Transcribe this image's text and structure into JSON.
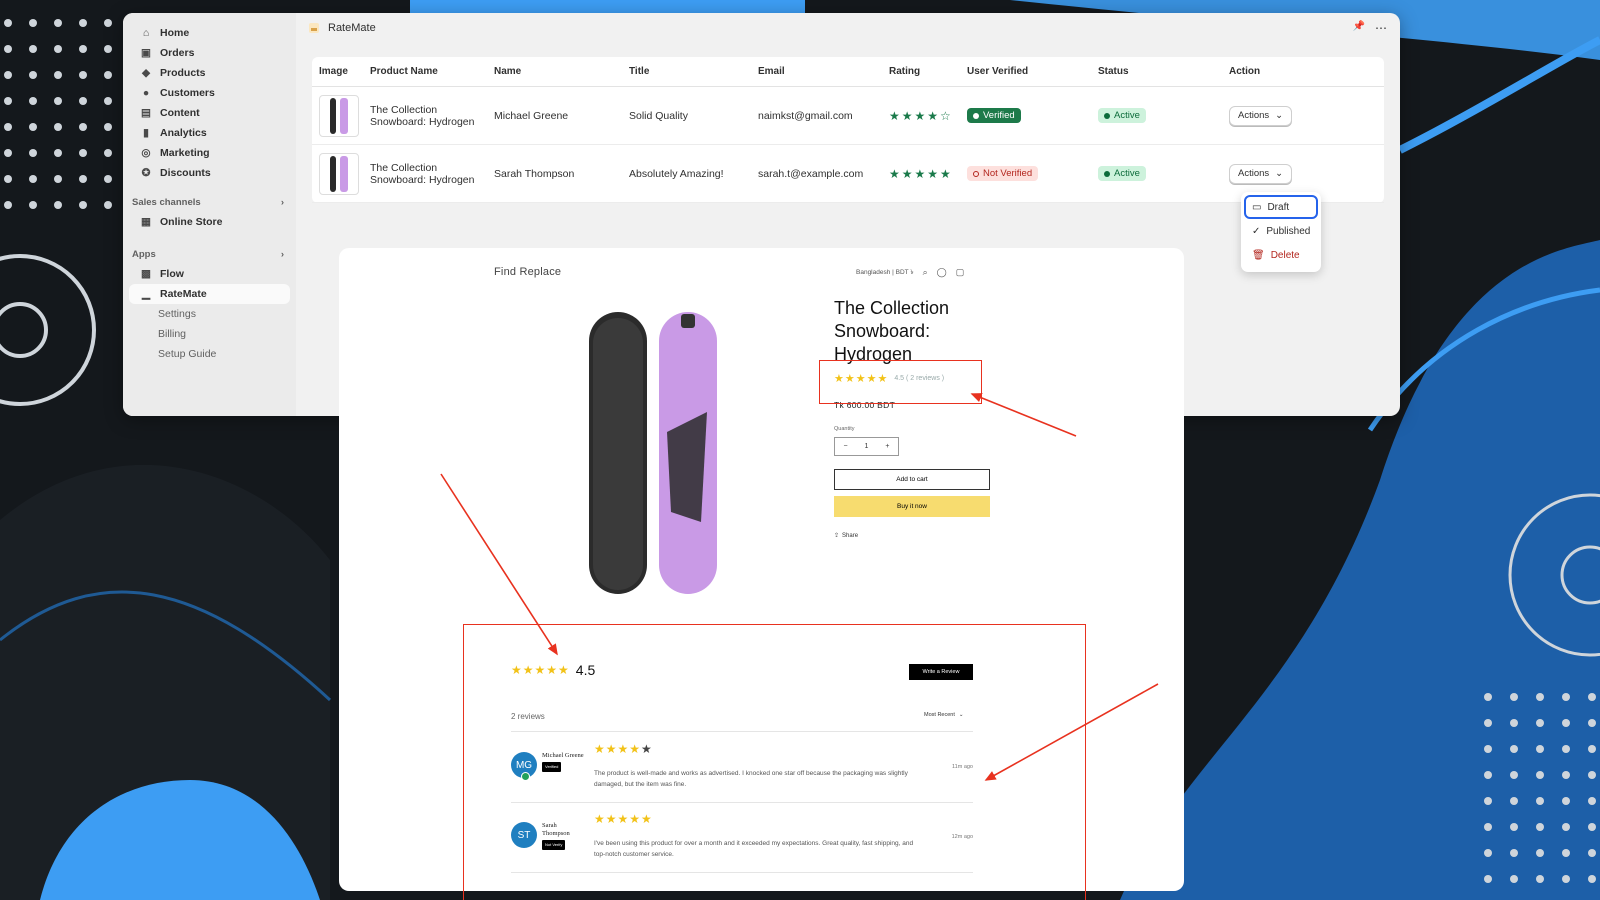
{
  "admin": {
    "app_title": "RateMate",
    "sidebar": {
      "items": [
        {
          "label": "Home",
          "icon": "home-icon"
        },
        {
          "label": "Orders",
          "icon": "orders-icon"
        },
        {
          "label": "Products",
          "icon": "tag-icon"
        },
        {
          "label": "Customers",
          "icon": "person-icon"
        },
        {
          "label": "Content",
          "icon": "content-icon"
        },
        {
          "label": "Analytics",
          "icon": "bar-chart-icon"
        },
        {
          "label": "Marketing",
          "icon": "target-icon"
        },
        {
          "label": "Discounts",
          "icon": "discount-icon"
        }
      ],
      "sales_channels_label": "Sales channels",
      "online_store_label": "Online Store",
      "apps_label": "Apps",
      "flow_label": "Flow",
      "ratemate_label": "RateMate",
      "sub_items": [
        "Settings",
        "Billing",
        "Setup Guide"
      ]
    },
    "table": {
      "headers": [
        "Image",
        "Product Name",
        "Name",
        "Title",
        "Email",
        "Rating",
        "User Verified",
        "Status",
        "Action"
      ],
      "rows": [
        {
          "product": "The Collection Snowboard: Hydrogen",
          "name": "Michael Greene",
          "title": "Solid Quality",
          "email": "naimkst@gmail.com",
          "rating": 4,
          "rating_stars": "★★★★☆",
          "verified": "Verified",
          "status": "Active",
          "action": "Actions"
        },
        {
          "product": "The Collection Snowboard: Hydrogen",
          "name": "Sarah Thompson",
          "title": "Absolutely Amazing!",
          "email": "sarah.t@example.com",
          "rating": 5,
          "rating_stars": "★★★★★",
          "verified": "Not Verified",
          "status": "Active",
          "action": "Actions"
        }
      ]
    },
    "dropdown": {
      "items": [
        "Draft",
        "Published",
        "Delete"
      ]
    }
  },
  "store": {
    "logo": "Find Replace",
    "locale": "Bangladesh | BDT ৳",
    "product_title": "The Collection Snowboard: Hydrogen",
    "rating_stars": "★★★★★",
    "rating_text": "4.5 ( 2 reviews )",
    "price": "Tk 600.00 BDT",
    "quantity_label": "Quantity",
    "quantity": "1",
    "qty_minus": "−",
    "qty_plus": "+",
    "add_to_cart": "Add to cart",
    "buy_now": "Buy it now",
    "share": "Share"
  },
  "reviews": {
    "average": "4.5",
    "summary_stars": "★★★★★",
    "write_review": "Write a Review",
    "count_text": "2 reviews",
    "sort_label": "Most Recent",
    "items": [
      {
        "initials": "MG",
        "name": "Michael Greene",
        "tag": "Verified",
        "stars": "★★★★",
        "stars_empty": "★",
        "rating": 4,
        "text": "The product is well-made and works as advertised. I knocked one star off because the packaging was slightly damaged, but the item was fine.",
        "time": "11m ago"
      },
      {
        "initials": "ST",
        "name": "Sarah Thompson",
        "tag": "Not Verify",
        "stars": "★★★★★",
        "stars_empty": "",
        "rating": 5,
        "text": "I've been using this product for over a month and it exceeded my expectations. Great quality, fast shipping, and top-notch customer service.",
        "time": "12m ago"
      }
    ]
  },
  "colors": {
    "bg_dark": "#14181c",
    "accent_blue": "#3d9df3",
    "annotation_red": "#e8321f",
    "star_green": "#1a7a4a",
    "star_yellow": "#f2c218"
  }
}
